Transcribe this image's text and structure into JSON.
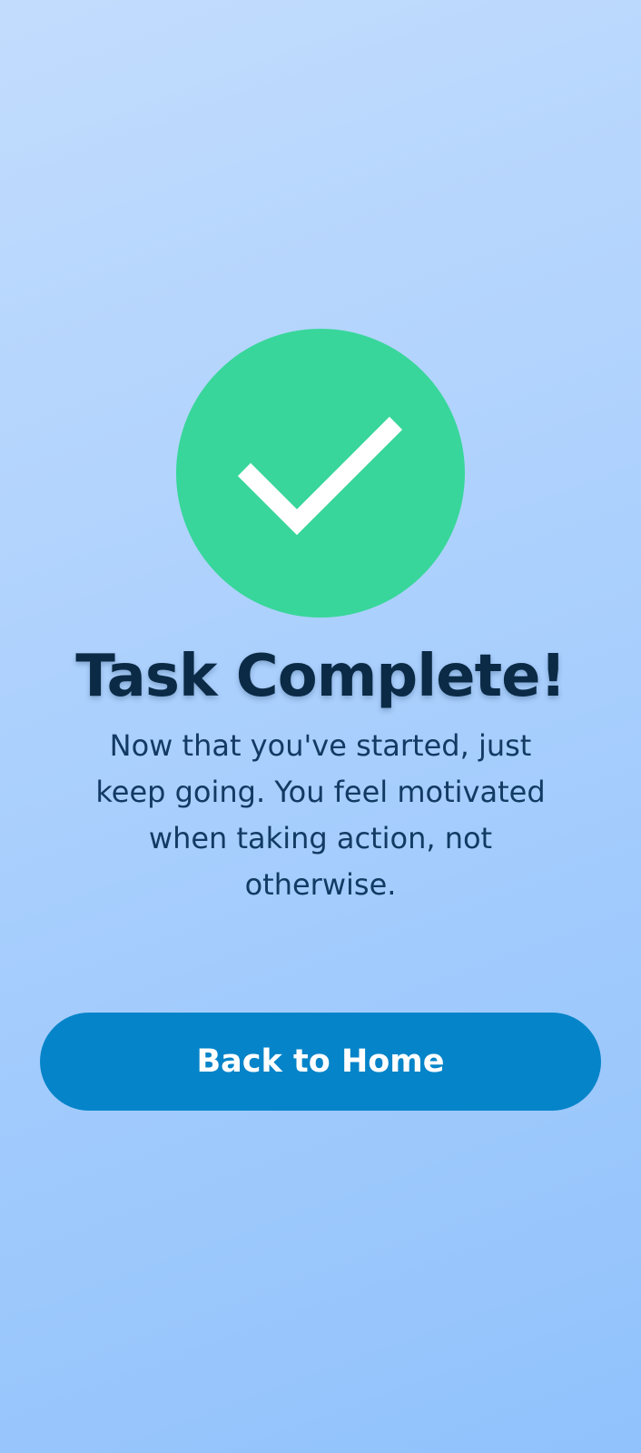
{
  "completion": {
    "icon": "checkmark-icon",
    "icon_color": "#38d69a",
    "title": "Task Complete!",
    "message": "Now that you've started, just keep going. You feel motivated when taking action, not otherwise."
  },
  "actions": {
    "home_label": "Back to Home",
    "home_color": "#0584c9"
  },
  "theme": {
    "background_start": "#c2dcfd",
    "background_end": "#91c2fc",
    "title_color": "#0b2a45"
  }
}
